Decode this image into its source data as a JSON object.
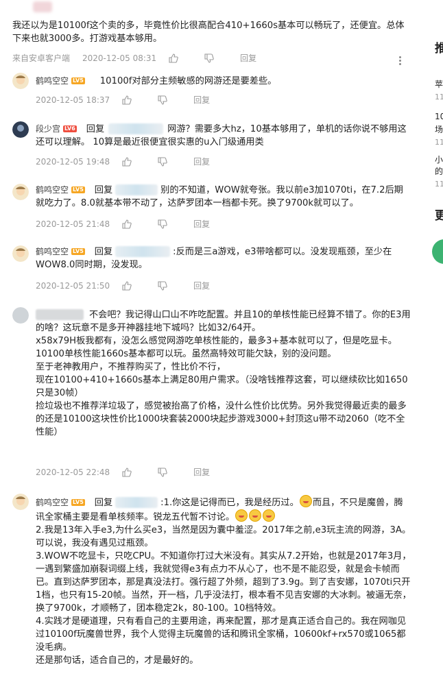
{
  "top_comment": {
    "text": "我还以为是10100f这个卖的多，毕竟性价比很高配合410+1660s基本可以畅玩了，还便宜。总体下来也就3000多。打游戏基本够用。",
    "source": "来自安卓客户端",
    "time": "2020-12-05 08:31",
    "reply": "回复"
  },
  "replies": [
    {
      "user": "鹤鸣空空",
      "level": "LV5",
      "prefix": "",
      "text": "10100f对部分主频敏感的网游还是要差些。",
      "time": "2020-12-05 18:37",
      "reply": "回复"
    },
    {
      "user": "段少宫",
      "level": "LV6",
      "prefix": "回复",
      "text": "网游？需要多大hz，10基本够用了，单机的话你说不够用这还可以理解。 10算是最近很便宜很实惠的u入门级通用类",
      "time": "2020-12-05 19:48",
      "reply": "回复"
    },
    {
      "user": "鹤鸣空空",
      "level": "LV5",
      "prefix": "回复",
      "text": "别的不知道，WOW就夸张。我以前e3加1070ti，在7.2后期就吃力了。8.0就基本带不动了，达萨罗团本一档都卡死。换了9700k就可以了。",
      "time": "2020-12-05 21:48",
      "reply": "回复"
    },
    {
      "user": "鹤鸣空空",
      "level": "LV5",
      "prefix": "回复",
      "text": ":反而是三a游戏，e3带啥都可以。没发现瓶颈，至少在WOW8.0同时期，没发现。",
      "time": "2020-12-05 21:50",
      "reply": "回复"
    },
    {
      "user": "",
      "level": "",
      "prefix": "",
      "text": "不会吧？我记得山口山不咋吃配置。并且10的单核性能已经算不错了。你的E3用的啥？这玩意不是多开神器挂地下城吗？比如32/64开。",
      "extra": [
        "x58x79H板我都有，没怎么感觉网游吃单核性能的，最多3+基本就可以了，但是吃显卡。",
        "10100单核性能1660s基本都可以玩。虽然高特效可能欠缺，别的没问题。",
        "至于老神教用户，不推荐购买了，性比价不行，",
        "现在10100+410+1660s基本上满足80用户需求。（没啥钱推荐这套，可以继续砍比如1650只是30帧）",
        "捡垃圾也不推荐洋垃圾了，感觉被抬高了价格，没什么性价比优势。另外我觉得最近卖的最多的还是10100这块性价比1000块套装2000块起步游戏3000+封顶这u带不动2060（吃不全性能）"
      ],
      "time": "2020-12-05 22:48",
      "reply": "回复"
    },
    {
      "user": "鹤鸣空空",
      "level": "LV5",
      "prefix": "回复",
      "text_a": ":1.你这是记得而已，我是经历过。",
      "text_b": "而且，不只是魔兽，腾讯全家桶主要是看单核频率。锐龙五代暂不讨论。",
      "extra": [
        "2.我是13年入手e3,为什么买e3，当然是因为囊中羞涩。2017年之前,e3玩主流的网游，3A。可以说，我没有遇见过瓶颈。",
        "3.WOW不吃显卡，只吃CPU。不知道你打过大米没有。其实从7.2开始，也就是2017年3月，一遇到繁盛加崩裂词缀上线，我就觉得e3有点力不从心了，也不是不能忍受，就是会卡帧而已。直到达萨罗团本，那是真没法打。强行超了外频，超到了3.9g。到了吉安娜，1070ti只开1档，也只有15-20帧。当然，开一档，几乎没法打，根本看不见吉安娜的大冰刺。被逼无奈，换了9700k，才顺畅了，团本稳定2k，80-100。10档特效。",
        "4.实践才是硬道理，只有看自己的主要用途，再来配置，那才是真正适合自己的。我在网咖见过10100f玩魔兽世界，我个人觉得主玩魔兽的话和腾讯全家桶，10600kf+rx570或1065都没毛病。",
        "还是那句话，适合自己的，才是最好的。"
      ]
    }
  ],
  "sidebar": {
    "title": "推",
    "lines": [
      "苹",
      "11",
      "10",
      "场",
      "11",
      "小",
      "的",
      "11",
      "更"
    ]
  }
}
